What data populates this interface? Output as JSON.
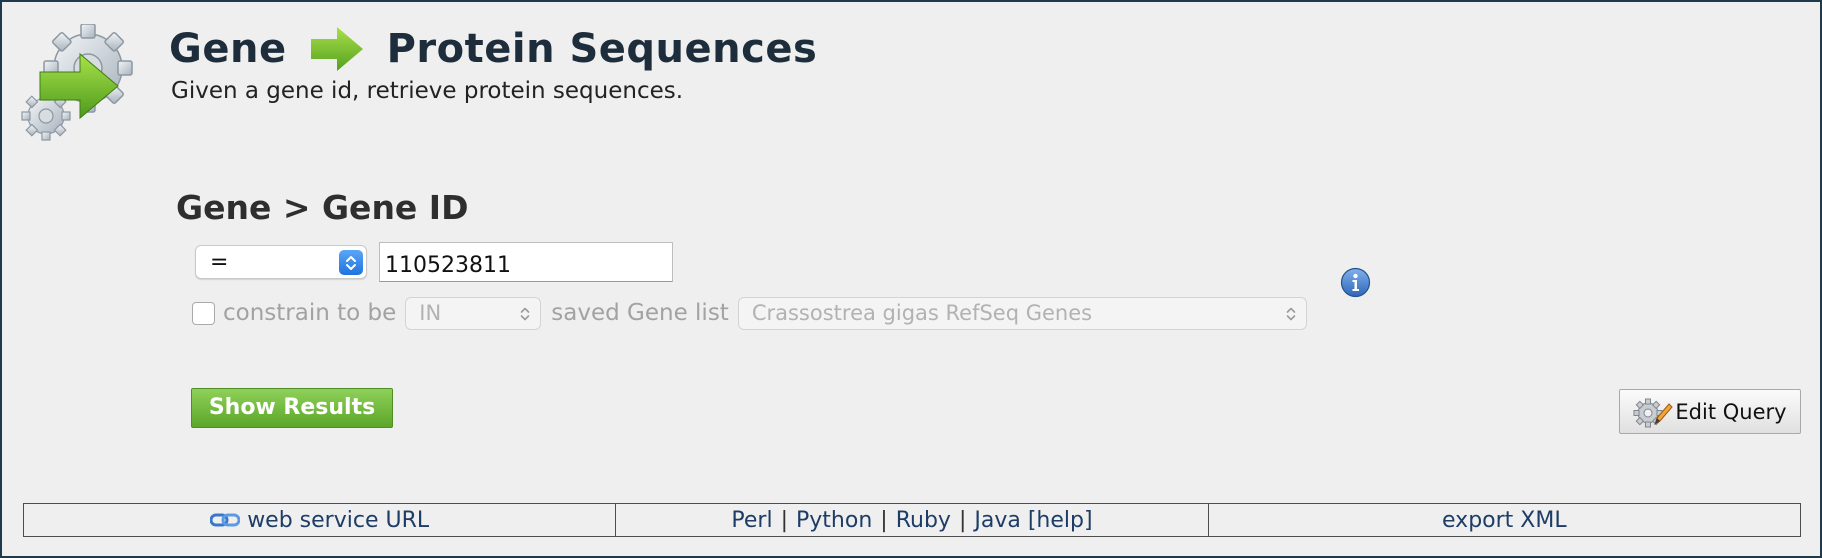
{
  "header": {
    "title_left": "Gene",
    "title_right": "Protein Sequences",
    "subtitle": "Given a gene id, retrieve protein sequences.",
    "icons": [
      "template-gears-logo",
      "arrow-right-icon"
    ]
  },
  "query": {
    "path_label": "Gene > Gene ID",
    "operator_value": "=",
    "input_value": "110523811",
    "constrain": {
      "checked": false,
      "label_prefix": "constrain to be",
      "in_value": "IN",
      "label_suffix": "saved Gene list",
      "list_value": "Crassostrea gigas RefSeq Genes"
    }
  },
  "actions": {
    "show_results_label": "Show Results",
    "edit_query_label": "Edit Query"
  },
  "footer": {
    "web_service_label": "web service URL",
    "languages": [
      "Perl",
      "Python",
      "Ruby",
      "Java"
    ],
    "help_label": "[help]",
    "export_label": "export XML"
  },
  "colors": {
    "background": "#efefef",
    "frame_border": "#1f3a4d",
    "title": "#1e2d3b",
    "button_green": "#6bb535",
    "link": "#1e3d66",
    "muted_text": "#a2a2a2"
  }
}
